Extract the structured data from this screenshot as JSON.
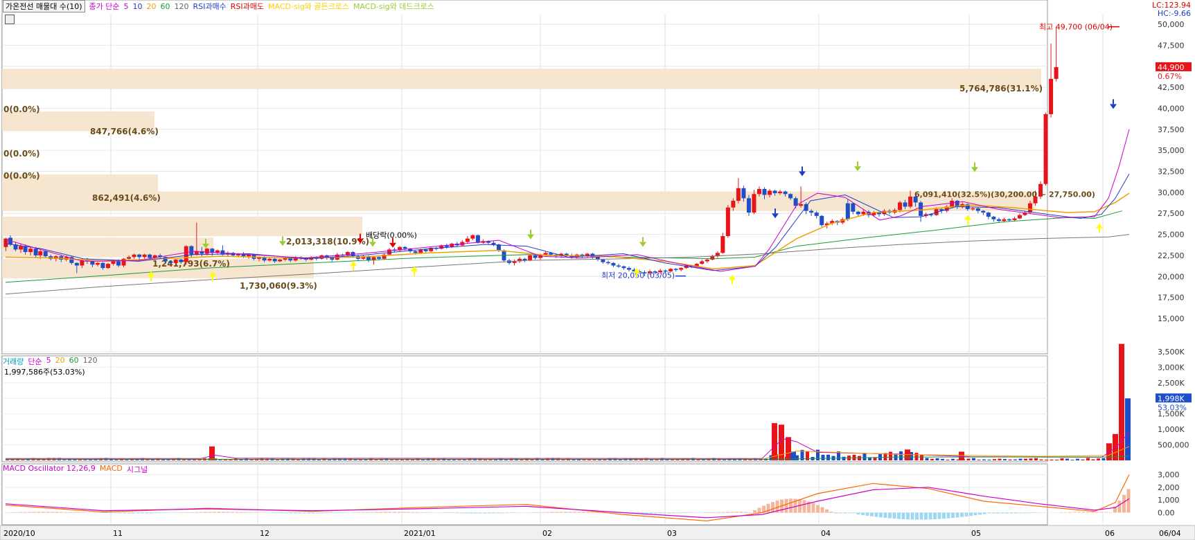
{
  "legend": {
    "title": "가온전선 매물대 수(10)",
    "items": [
      {
        "label": "종가 단순",
        "color": "#cc00cc"
      },
      {
        "label": "5",
        "color": "#cc00cc"
      },
      {
        "label": "10",
        "color": "#1f3cc8"
      },
      {
        "label": "20",
        "color": "#f0a000"
      },
      {
        "label": "60",
        "color": "#1a9a3a"
      },
      {
        "label": "120",
        "color": "#666666"
      },
      {
        "label": "RSI과매수",
        "color": "#1f3cc8"
      },
      {
        "label": "RSI과매도",
        "color": "#e00000"
      },
      {
        "label": "MACD-sig와 골든크로스",
        "color": "#ffd000"
      },
      {
        "label": "MACD-sig와 데드크로스",
        "color": "#9acd32"
      }
    ]
  },
  "corner": {
    "lc": "LC:123.94",
    "hc": "HC:-9.66"
  },
  "volume_legend": {
    "items": [
      {
        "label": "거래량",
        "color": "#00a0c0"
      },
      {
        "label": "단순",
        "color": "#cc00cc"
      },
      {
        "label": "5",
        "color": "#cc00cc"
      },
      {
        "label": "20",
        "color": "#f0a000"
      },
      {
        "label": "60",
        "color": "#1a9a3a"
      },
      {
        "label": "120",
        "color": "#666666"
      }
    ],
    "current": "1,997,586주(53.03%)"
  },
  "macd_legend": {
    "items": [
      {
        "label": "MACD Oscillator 12,26,9",
        "color": "#cc00cc"
      },
      {
        "label": "MACD",
        "color": "#ff6600"
      },
      {
        "label": "시그널",
        "color": "#cc00cc"
      }
    ]
  },
  "chart_data": {
    "type": "candlestick",
    "price_axis": {
      "min": 15000,
      "max": 50000,
      "ticks": [
        "50,000",
        "47,500",
        "45,000",
        "42,500",
        "40,000",
        "37,500",
        "35,000",
        "32,500",
        "30,000",
        "27,500",
        "25,000",
        "22,500",
        "20,000",
        "17,500",
        "15,000"
      ]
    },
    "volume_axis": {
      "ticks": [
        "3,500K",
        "3,000K",
        "2,500K",
        "2,000K",
        "1,500K",
        "1,000K",
        "500,000"
      ]
    },
    "macd_axis": {
      "ticks": [
        "3,000",
        "2,000",
        "1,000",
        "0.00"
      ]
    },
    "x_labels": [
      "2020/10",
      "11",
      "12",
      "2021/01",
      "02",
      "03",
      "04",
      "05",
      "06",
      "06/04"
    ],
    "current_price": {
      "value": "44,900",
      "change": "0.67%"
    },
    "current_volume": {
      "value": "1,998K",
      "pct": "53.03%"
    },
    "annotations": {
      "high": "최고 49,700 (06/04)",
      "low": "최저 20,050 (03/05)",
      "dividend": "배당락(0.00%)",
      "range_label": "6,091,410(32.5%)(30,200.00 ~ 27,750.00)"
    },
    "volume_profile": [
      {
        "label": "5,764,786(31.1%)",
        "lo": 42200,
        "hi": 44800
      },
      {
        "label": "0(0.0%)",
        "lo": 39700,
        "hi": 42200
      },
      {
        "label": "847,766(4.6%)",
        "lo": 37200,
        "hi": 39700
      },
      {
        "label": "0(0.0%)",
        "lo": 34700,
        "hi": 37200
      },
      {
        "label": "0(0.0%)",
        "lo": 32200,
        "hi": 34700
      },
      {
        "label": "862,491(4.6%)",
        "lo": 29700,
        "hi": 32200
      },
      {
        "label": "",
        "lo": 27700,
        "hi": 30200
      },
      {
        "label": "2,013,318(10.9%)",
        "lo": 24700,
        "hi": 27200
      },
      {
        "label": "1,241,793(6.7%)",
        "lo": 22200,
        "hi": 24700
      },
      {
        "label": "1,730,060(9.3%)",
        "lo": 19700,
        "hi": 22200
      }
    ]
  }
}
